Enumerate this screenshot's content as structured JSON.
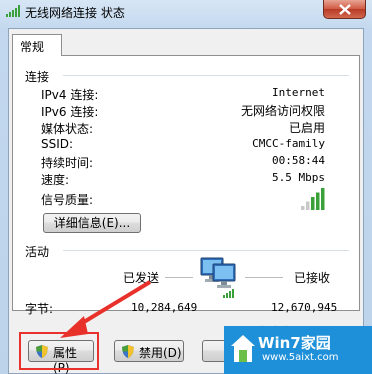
{
  "window": {
    "title": "无线网络连接 状态"
  },
  "tab": {
    "label": "常规"
  },
  "connection": {
    "section_title": "连接",
    "rows": [
      {
        "label": "IPv4 连接:",
        "value": "Internet"
      },
      {
        "label": "IPv6 连接:",
        "value": "无网络访问权限"
      },
      {
        "label": "媒体状态:",
        "value": "已启用"
      },
      {
        "label": "SSID:",
        "value": "CMCC-family"
      },
      {
        "label": "持续时间:",
        "value": "00:58:44"
      },
      {
        "label": "速度:",
        "value": "5.5 Mbps"
      }
    ],
    "signal_label": "信号质量:",
    "signal_bars_lit": 3,
    "signal_bars_total": 5,
    "details_button": "详细信息(E)..."
  },
  "activity": {
    "section_title": "活动",
    "sent_label": "已发送",
    "received_label": "已接收",
    "bytes_label": "字节:",
    "bytes_sent": "10,284,649",
    "bytes_received": "12,670,945"
  },
  "buttons": {
    "properties": "属性(P)",
    "disable": "禁用(D)"
  },
  "overlay": {
    "logo_text": "Win7家园",
    "logo_sub": "www.5aixt.com",
    "watermark": "系统"
  },
  "colors": {
    "highlight": "#e8312a",
    "signal_lit": "#3aa13a",
    "signal_dim": "#c8c8c8"
  }
}
